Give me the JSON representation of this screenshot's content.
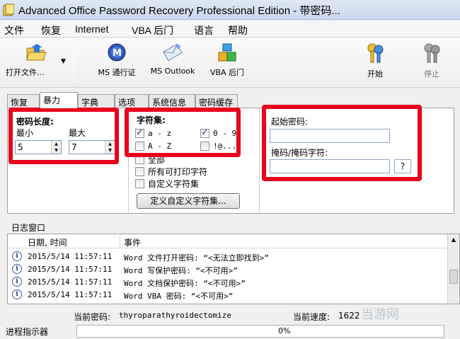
{
  "window": {
    "title": "Advanced Office Password Recovery Professional Edition - 带密码..."
  },
  "menu": [
    "文件",
    "恢复",
    "Internet",
    "VBA 后门",
    "语言",
    "帮助"
  ],
  "toolbar": {
    "open": "打开文件...",
    "ms_pass": "MS 通行证",
    "ms_outlook": "MS Outlook",
    "vba": "VBA 后门",
    "start": "开始",
    "stop": "停止"
  },
  "tabs": [
    "恢复",
    "暴力",
    "字典",
    "选项",
    "系统信息",
    "密码缓存"
  ],
  "brute": {
    "length_title": "密码长度:",
    "min_label": "最小",
    "max_label": "最大",
    "min_value": "5",
    "max_value": "7",
    "charset_title": "字符集:",
    "charsets": [
      {
        "label": "a - z",
        "checked": true
      },
      {
        "label": "0 - 9",
        "checked": true
      },
      {
        "label": "A - Z",
        "checked": false
      },
      {
        "label": "!@...",
        "checked": false
      }
    ],
    "all_label": "全部",
    "printable_label": "所有可打印字符",
    "custom_label": "自定义字符集",
    "define_button": "定义自定义字符集...",
    "start_pw_label": "起始密码:",
    "mask_label": "掩码/掩码字符:",
    "mask_char_button": "?"
  },
  "log": {
    "window_label": "日志窗口",
    "col_date": "日期, 时间",
    "col_event": "事件",
    "rows": [
      {
        "date": "2015/5/14 11:57:11",
        "event": "Word 文件打开密码: “<无法立即找到>”"
      },
      {
        "date": "2015/5/14 11:57:11",
        "event": "Word 写保护密码: “<不可用>”"
      },
      {
        "date": "2015/5/14 11:57:11",
        "event": "Word 文档保护密码: “<不可用>”"
      },
      {
        "date": "2015/5/14 11:57:11",
        "event": "Word VBA 密码: “<不可用>”"
      }
    ]
  },
  "status": {
    "current_pw_label": "当前密码:",
    "current_pw_value": "thyroparathyroidectomize",
    "speed_label": "当前速度:",
    "speed_value": "1622"
  },
  "progress": {
    "label": "进程指示器",
    "value_text": "0%",
    "value": 0
  },
  "watermark": "当游网",
  "colors": {
    "highlight_box": "#e8001c"
  }
}
